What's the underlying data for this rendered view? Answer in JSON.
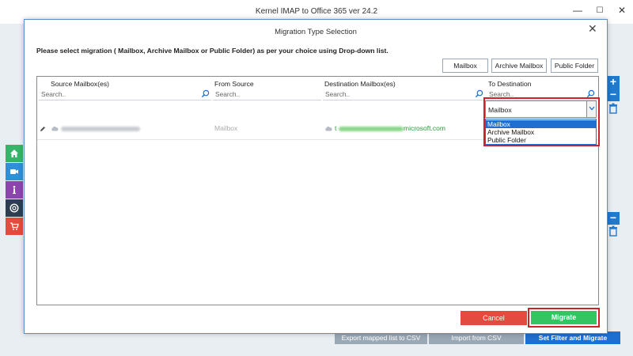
{
  "app": {
    "title": "Kernel IMAP to Office 365 ver 24.2",
    "window_controls": {
      "minimize": "—",
      "maximize": "☐",
      "close": "✕"
    },
    "bottom_buttons": [
      "Export mapped list to CSV",
      "Import from CSV",
      "Set Filter and Migrate"
    ],
    "side_icons": [
      "home-icon",
      "video-icon",
      "info-icon",
      "help-icon",
      "cart-icon"
    ],
    "colors": {
      "accent_blue": "#1e7bd0",
      "dialog_border": "#5a8ec4"
    }
  },
  "dialog": {
    "title": "Migration Type Selection",
    "close": "✕",
    "instruction": "Please select migration ( Mailbox, Archive Mailbox or Public Folder) as per your choice using Drop-down list.",
    "type_buttons": [
      "Mailbox",
      "Archive Mailbox",
      "Public Folder"
    ],
    "grid": {
      "columns": [
        "Source Mailbox(es)",
        "From Source",
        "Destination Mailbox(es)",
        "To Destination"
      ],
      "search_placeholder": "Search..",
      "rows": [
        {
          "source": "",
          "from_source": "Mailbox",
          "destination_prefix": "t",
          "destination_suffix": "microsoft.com",
          "to_destination": "Mailbox"
        }
      ]
    },
    "dropdown": {
      "selected": "Mailbox",
      "options": [
        "Mailbox",
        "Archive Mailbox",
        "Public Folder"
      ]
    },
    "cancel_label": "Cancel",
    "migrate_label": "Migrate",
    "colors": {
      "cancel": "#e34b3f",
      "migrate": "#35c462",
      "highlight": "#cc2229"
    }
  }
}
